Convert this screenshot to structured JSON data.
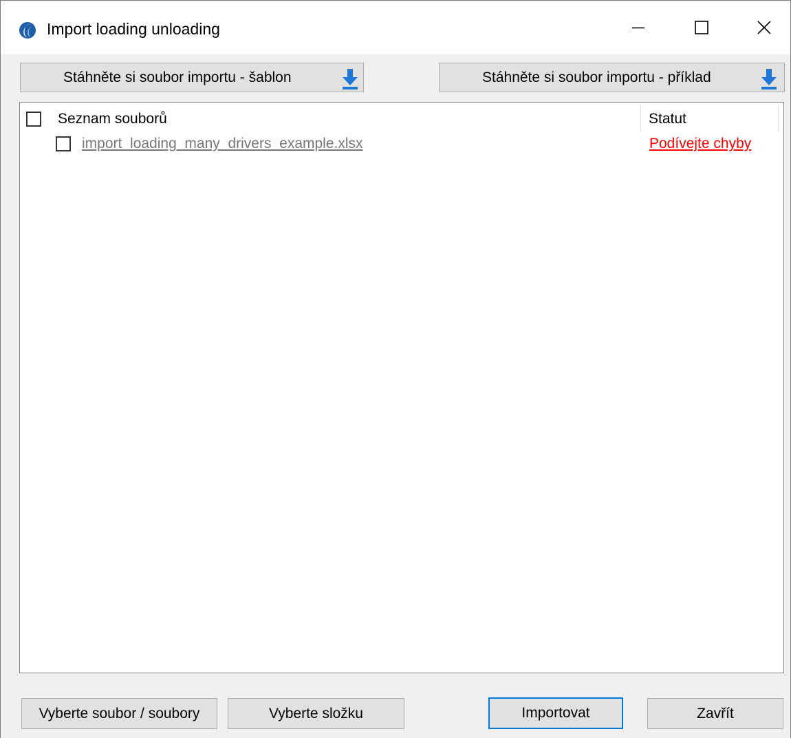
{
  "window": {
    "title": "Import loading unloading",
    "app_icon": "app-logo-icon",
    "controls": [
      "minimize-icon",
      "maximize-icon",
      "close-icon"
    ]
  },
  "toolbar": {
    "download_template_label": "Stáhněte si soubor importu - šablon",
    "download_example_label": "Stáhněte si soubor importu - příklad",
    "download_icon": "download-icon",
    "accent_color": "#1e78d7"
  },
  "file_list": {
    "header_files": "Seznam souborů",
    "header_status": "Statut",
    "rows": [
      {
        "file": "import_loading_many_drivers_example.xlsx",
        "status": "Podívejte chyby",
        "status_color": "#ff0000"
      }
    ]
  },
  "footer": {
    "select_files_label": "Vyberte soubor / soubory",
    "select_folder_label": "Vyberte složku",
    "import_label": "Importovat",
    "close_label": "Zavřít"
  }
}
